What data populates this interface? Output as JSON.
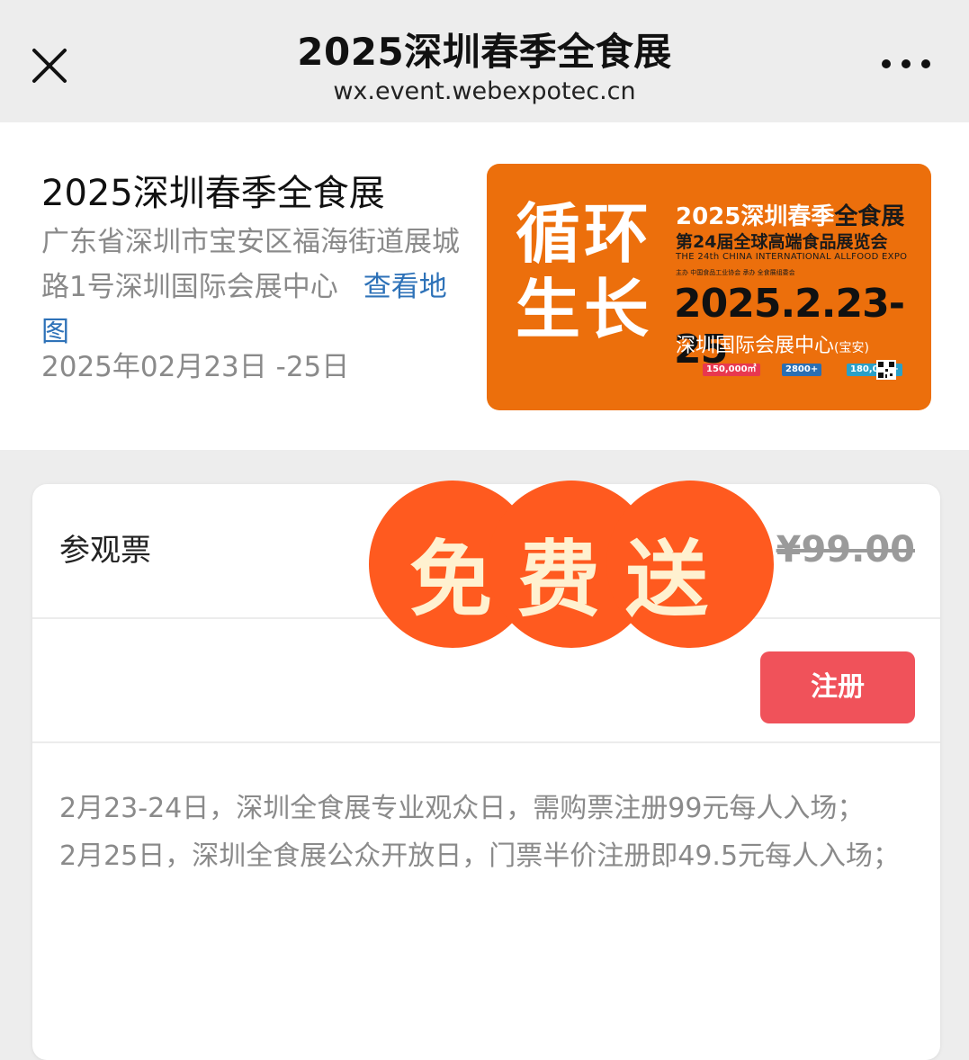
{
  "nav": {
    "title": "2025深圳春季全食展",
    "url": "wx.event.webexpotec.cn"
  },
  "event": {
    "name": "2025深圳春季全食展",
    "address": "广东省深圳市宝安区福海街道展城路1号深圳国际会展中心",
    "map_link": "查看地图",
    "date": "2025年02月23日 -25日"
  },
  "poster": {
    "slogan_line1": "循环",
    "slogan_line2": "生长",
    "title_prefix": "2025深圳春季",
    "title_suffix": "全食展",
    "subtitle": "第24届全球高端食品展览会",
    "english": "THE 24th CHINA INTERNATIONAL ALLFOOD EXPO",
    "organizers": "主办 中国食品工业协会  承办 全食展组委会",
    "dates": "2025.2.23-25",
    "venue": "深圳国际会展中心",
    "venue_note": "(宝安)",
    "stats": [
      "150,000㎡",
      "2800+",
      "180,000+"
    ],
    "colors": {
      "background": "#ec6f0c",
      "stat1": "#e8384f",
      "stat2": "#2a6fb3",
      "stat3": "#2aa0c8"
    }
  },
  "ticket": {
    "name": "参观票",
    "price": "¥99.00",
    "register_button": "注册",
    "description": [
      "2月23-24日，深圳全食展专业观众日，需购票注册99元每人入场；",
      "2月25日，深圳全食展公众开放日，门票半价注册即49.5元每人入场；"
    ]
  },
  "stamp": {
    "text": "免费送",
    "color": "#ff5a1f"
  }
}
